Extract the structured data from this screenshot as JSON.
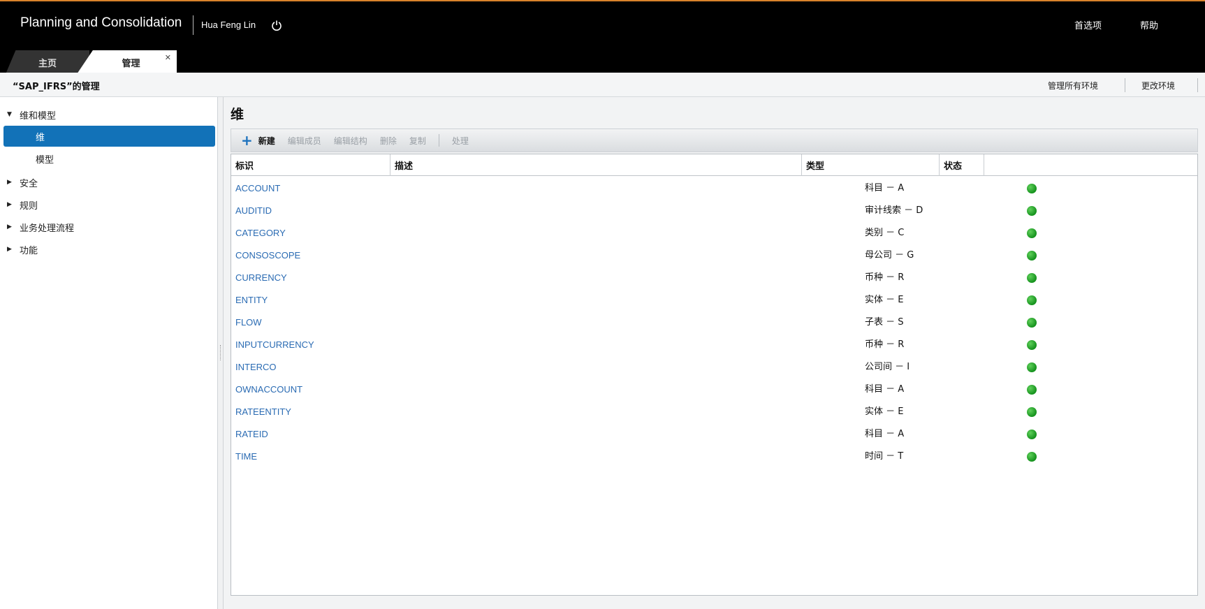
{
  "header": {
    "app_title": "Planning and Consolidation",
    "user_name": "Hua Feng Lin",
    "preferences": "首选项",
    "help": "帮助"
  },
  "tabs": [
    {
      "label": "主页",
      "active": false
    },
    {
      "label": "管理",
      "active": true
    }
  ],
  "sub_header": {
    "title": "“SAP_IFRS”的管理",
    "manage_all": "管理所有环境",
    "change_env": "更改环境"
  },
  "sidebar": {
    "items": [
      {
        "label": "维和模型",
        "expanded": true,
        "children": [
          {
            "label": "维",
            "selected": true
          },
          {
            "label": "模型",
            "selected": false
          }
        ]
      },
      {
        "label": "安全",
        "expanded": false
      },
      {
        "label": "规则",
        "expanded": false
      },
      {
        "label": "业务处理流程",
        "expanded": false
      },
      {
        "label": "功能",
        "expanded": false
      }
    ]
  },
  "main": {
    "title": "维",
    "toolbar": {
      "new": "新建",
      "edit_members": "编辑成员",
      "edit_structure": "编辑结构",
      "delete": "删除",
      "copy": "复制",
      "process": "处理"
    },
    "columns": {
      "id": "标识",
      "description": "描述",
      "type": "类型",
      "status": "状态"
    },
    "rows": [
      {
        "id": "ACCOUNT",
        "description": "",
        "type": "科目 － A",
        "status": "green"
      },
      {
        "id": "AUDITID",
        "description": "",
        "type": "审计线索 － D",
        "status": "green"
      },
      {
        "id": "CATEGORY",
        "description": "",
        "type": "类别 － C",
        "status": "green"
      },
      {
        "id": "CONSOSCOPE",
        "description": "",
        "type": "母公司 － G",
        "status": "green"
      },
      {
        "id": "CURRENCY",
        "description": "",
        "type": "币种 － R",
        "status": "green"
      },
      {
        "id": "ENTITY",
        "description": "",
        "type": "实体 － E",
        "status": "green"
      },
      {
        "id": "FLOW",
        "description": "",
        "type": "子表 － S",
        "status": "green"
      },
      {
        "id": "INPUTCURRENCY",
        "description": "",
        "type": "币种 － R",
        "status": "green"
      },
      {
        "id": "INTERCO",
        "description": "",
        "type": "公司间 － I",
        "status": "green"
      },
      {
        "id": "OWNACCOUNT",
        "description": "",
        "type": "科目 － A",
        "status": "green"
      },
      {
        "id": "RATEENTITY",
        "description": "",
        "type": "实体 － E",
        "status": "green"
      },
      {
        "id": "RATEID",
        "description": "",
        "type": "科目 － A",
        "status": "green"
      },
      {
        "id": "TIME",
        "description": "",
        "type": "时间 － T",
        "status": "green"
      }
    ]
  },
  "colors": {
    "accent": "#1272b8",
    "link": "#2a6bb3",
    "status_ok": "#15921d"
  }
}
